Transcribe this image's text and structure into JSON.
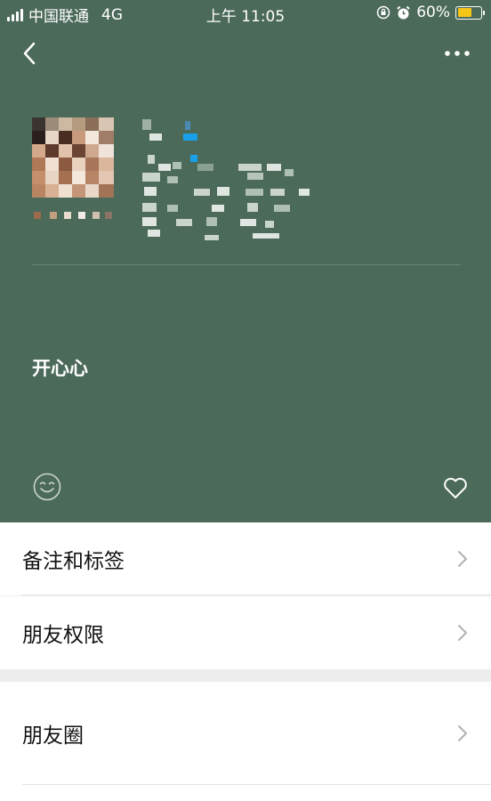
{
  "status_bar": {
    "carrier": "中国联通",
    "network": "4G",
    "time": "上午 11:05",
    "battery": "60%",
    "battery_level": 0.6
  },
  "profile": {
    "signature": "开心心",
    "accent_color": "#4c6a5a"
  },
  "menu": {
    "remarks_tags": "备注和标签",
    "friend_permissions": "朋友权限",
    "moments": "朋友圈"
  }
}
